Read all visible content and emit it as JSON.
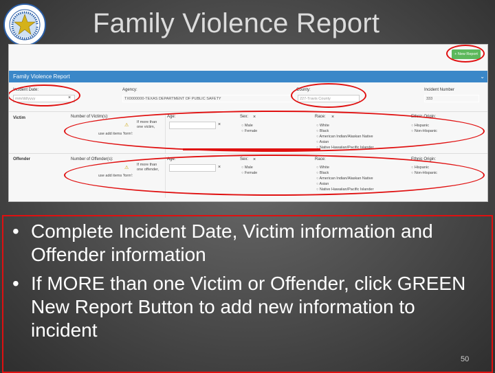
{
  "slide": {
    "title": "Family Violence Report",
    "page_number": "50",
    "bullets": [
      "Complete Incident Date, Victim information and Offender information",
      "If MORE than one Victim or Offender, click GREEN New Report Button to add new information to incident"
    ],
    "bullet_symbol": "•"
  },
  "seal": {
    "icon": "texas-dps-seal-icon",
    "colors": {
      "outer": "#2b5fa8",
      "star": "#d4b21a"
    }
  },
  "app": {
    "new_report_button": "+ New Report",
    "panel_title": "Family Violence Report",
    "chevron": "⌄",
    "header_fields": {
      "incident_date_label": "Incident Date:",
      "incident_date_placeholder": "mm/dd/yyyy",
      "agency_label": "Agency:",
      "agency_value": "TX0000000-TEXAS DEPARTMENT OF PUBLIC SAFETY",
      "county_label": "County:",
      "county_value": "227-Travis County",
      "incident_number_label": "Incident Number",
      "incident_number_value": "333"
    },
    "rows": [
      {
        "row_label": "Victim",
        "count_label": "Number of Victim(s):",
        "warning_text": "If more than one victim,",
        "add_hint": "use add items 'form':",
        "age_label": "Age:",
        "sex_label": "Sex:",
        "sex_options": [
          "Male",
          "Female"
        ],
        "race_label": "Race:",
        "race_options": [
          "White",
          "Black",
          "American Indian/Alaskan Native",
          "Asian",
          "Native Hawaiian/Pacific Islander"
        ],
        "ethnic_label": "Ethnic Origin:",
        "ethnic_options": [
          "Hispanic",
          "Non-Hispanic"
        ]
      },
      {
        "row_label": "Offender",
        "count_label": "Number of Offender(s):",
        "warning_text": "If more than one offender,",
        "add_hint": "use add items 'form':",
        "age_label": "Age:",
        "sex_label": "Sex:",
        "sex_options": [
          "Male",
          "Female"
        ],
        "race_label": "Race:",
        "race_options": [
          "White",
          "Black",
          "American Indian/Alaskan Native",
          "Asian",
          "Native Hawaiian/Pacific Islander"
        ],
        "ethnic_label": "Ethnic Origin:",
        "ethnic_options": [
          "Hispanic",
          "Non-Hispanic"
        ]
      }
    ],
    "close_mark": "×"
  },
  "colors": {
    "highlight": "#e01010",
    "accent_blue": "#3a87c8",
    "green_button": "#5cb85c",
    "text_white": "#ffffff"
  }
}
